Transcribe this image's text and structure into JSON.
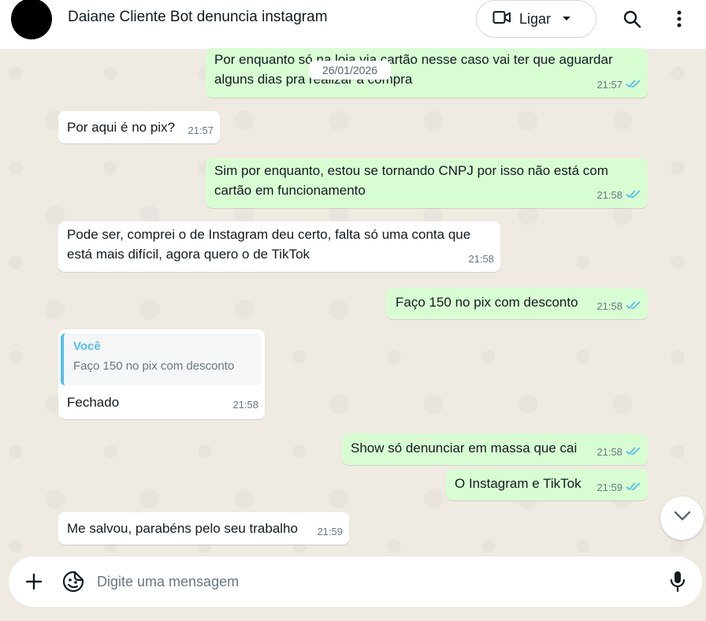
{
  "header": {
    "contact_name": "Daiane Cliente Bot denuncia instagram",
    "call_label": "Ligar",
    "icons": [
      "video-icon",
      "caret-down-icon",
      "search-icon",
      "more-vert-icon"
    ]
  },
  "chat": {
    "date_chip": "26/01/2026",
    "messages": [
      {
        "dir": "out",
        "text_line1": "Por enquanto só na loja via cartão nesse caso vai ter que aguardar",
        "text_line2": "alguns dias pra realizar a compra",
        "time": "21:57",
        "read": true
      },
      {
        "dir": "in",
        "text": "Por aqui é no pix?",
        "time": "21:57"
      },
      {
        "dir": "out",
        "text_line1": "Sim por enquanto, estou se tornando CNPJ por isso não está com",
        "text_line2": "cartão em funcionamento",
        "time": "21:58",
        "read": true
      },
      {
        "dir": "in",
        "text_line1": "Pode ser, comprei o de Instagram deu certo, falta só uma conta que",
        "text_line2": "está mais difícil, agora quero o de TikTok",
        "time": "21:58"
      },
      {
        "dir": "out",
        "text": "Faço 150 no pix com desconto",
        "time": "21:58",
        "read": true
      },
      {
        "dir": "in",
        "quote_author": "Você",
        "quote_text": "Faço 150 no pix com desconto",
        "text": "Fechado",
        "time": "21:58"
      },
      {
        "dir": "out",
        "text": "Show só denunciar em massa que cai",
        "time": "21:58",
        "read": true
      },
      {
        "dir": "out",
        "text": "O Instagram e TikTok",
        "time": "21:59",
        "read": true
      },
      {
        "dir": "in",
        "text": "Me salvou, parabéns pelo seu trabalho",
        "time": "21:59"
      }
    ]
  },
  "composer": {
    "placeholder": "Digite uma mensagem",
    "value": ""
  },
  "colors": {
    "outgoing_bubble": "#d9fdd3",
    "incoming_bubble": "#ffffff",
    "read_tick": "#53bdeb",
    "background": "#efeae2"
  }
}
